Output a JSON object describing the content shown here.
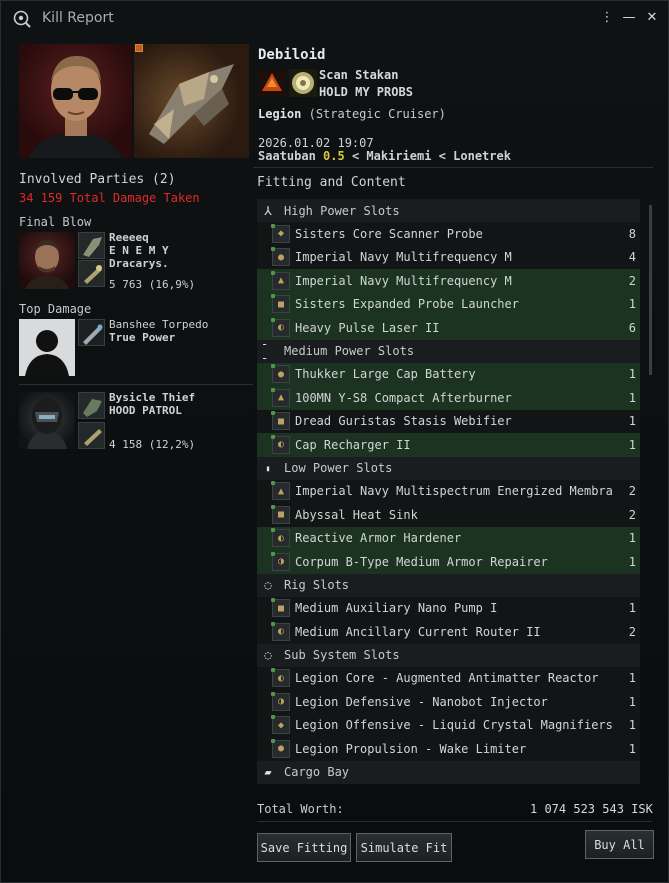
{
  "window": {
    "title": "Kill Report"
  },
  "victim": {
    "name": "Debiloid",
    "corp": "Scan Stakan",
    "alliance": "HOLD MY PROBS",
    "ship_name": "Legion",
    "ship_class": "(Strategic Cruiser)",
    "datetime": "2026.01.02 19:07",
    "system": "Saatuban",
    "security": "0.5",
    "constellation": "Makiriemi",
    "region": "Lonetrek",
    "loc_sep": "<"
  },
  "involved": {
    "title": "Involved Parties (2)",
    "damage_taken": "34 159 Total Damage Taken",
    "final_blow_label": "Final Blow",
    "top_damage_label": "Top Damage",
    "final_blow": {
      "name": "Reeeeq",
      "corp": "E N E M Y",
      "alliance": "Dracarys.",
      "damage": "5 763 (16,9%)"
    },
    "top_damage": {
      "name": "Banshee Torpedo",
      "corp": "True Power"
    },
    "other": {
      "name": "Bysicle Thief",
      "corp": "HOOD PATROL",
      "damage": "4 158 (12,2%)"
    }
  },
  "fitting": {
    "title": "Fitting and Content",
    "sections": [
      {
        "label": "High Power Slots",
        "icon": "high-slot-icon",
        "items": [
          {
            "name": "Sisters Core Scanner Probe",
            "qty": "8",
            "fitted": false
          },
          {
            "name": "Imperial Navy Multifrequency M",
            "qty": "4",
            "fitted": false
          },
          {
            "name": "Imperial Navy Multifrequency M",
            "qty": "2",
            "fitted": true
          },
          {
            "name": "Sisters Expanded Probe Launcher",
            "qty": "1",
            "fitted": true
          },
          {
            "name": "Heavy Pulse Laser II",
            "qty": "6",
            "fitted": true
          }
        ]
      },
      {
        "label": "Medium Power Slots",
        "icon": "mid-slot-icon",
        "items": [
          {
            "name": "Thukker Large Cap Battery",
            "qty": "1",
            "fitted": true
          },
          {
            "name": "100MN Y-S8 Compact Afterburner",
            "qty": "1",
            "fitted": true
          },
          {
            "name": "Dread Guristas Stasis Webifier",
            "qty": "1",
            "fitted": false
          },
          {
            "name": "Cap Recharger II",
            "qty": "1",
            "fitted": true
          }
        ]
      },
      {
        "label": "Low Power Slots",
        "icon": "low-slot-icon",
        "items": [
          {
            "name": "Imperial Navy Multispectrum Energized Membra",
            "qty": "2",
            "fitted": false
          },
          {
            "name": "Abyssal Heat Sink",
            "qty": "2",
            "fitted": false
          },
          {
            "name": "Reactive Armor Hardener",
            "qty": "1",
            "fitted": true
          },
          {
            "name": "Corpum B-Type Medium Armor Repairer",
            "qty": "1",
            "fitted": true
          }
        ]
      },
      {
        "label": "Rig Slots",
        "icon": "rig-slot-icon",
        "items": [
          {
            "name": "Medium Auxiliary Nano Pump I",
            "qty": "1",
            "fitted": false
          },
          {
            "name": "Medium Ancillary Current Router II",
            "qty": "2",
            "fitted": false
          }
        ]
      },
      {
        "label": "Sub System Slots",
        "icon": "subsystem-slot-icon",
        "items": [
          {
            "name": "Legion Core - Augmented Antimatter Reactor",
            "qty": "1",
            "fitted": false
          },
          {
            "name": "Legion Defensive - Nanobot Injector",
            "qty": "1",
            "fitted": false
          },
          {
            "name": "Legion Offensive - Liquid Crystal Magnifiers",
            "qty": "1",
            "fitted": false
          },
          {
            "name": "Legion Propulsion - Wake Limiter",
            "qty": "1",
            "fitted": false
          }
        ]
      },
      {
        "label": "Cargo Bay",
        "icon": "cargo-icon",
        "items": []
      }
    ]
  },
  "footer": {
    "worth_label": "Total Worth:",
    "worth_value": "1 074 523 543 ISK",
    "save_fitting": "Save Fitting",
    "simulate_fit": "Simulate Fit",
    "buy_all": "Buy All"
  },
  "colors": {
    "accent_red": "#e02a2a",
    "fitted_row": "#1b3320",
    "security": "#d8c83a"
  }
}
